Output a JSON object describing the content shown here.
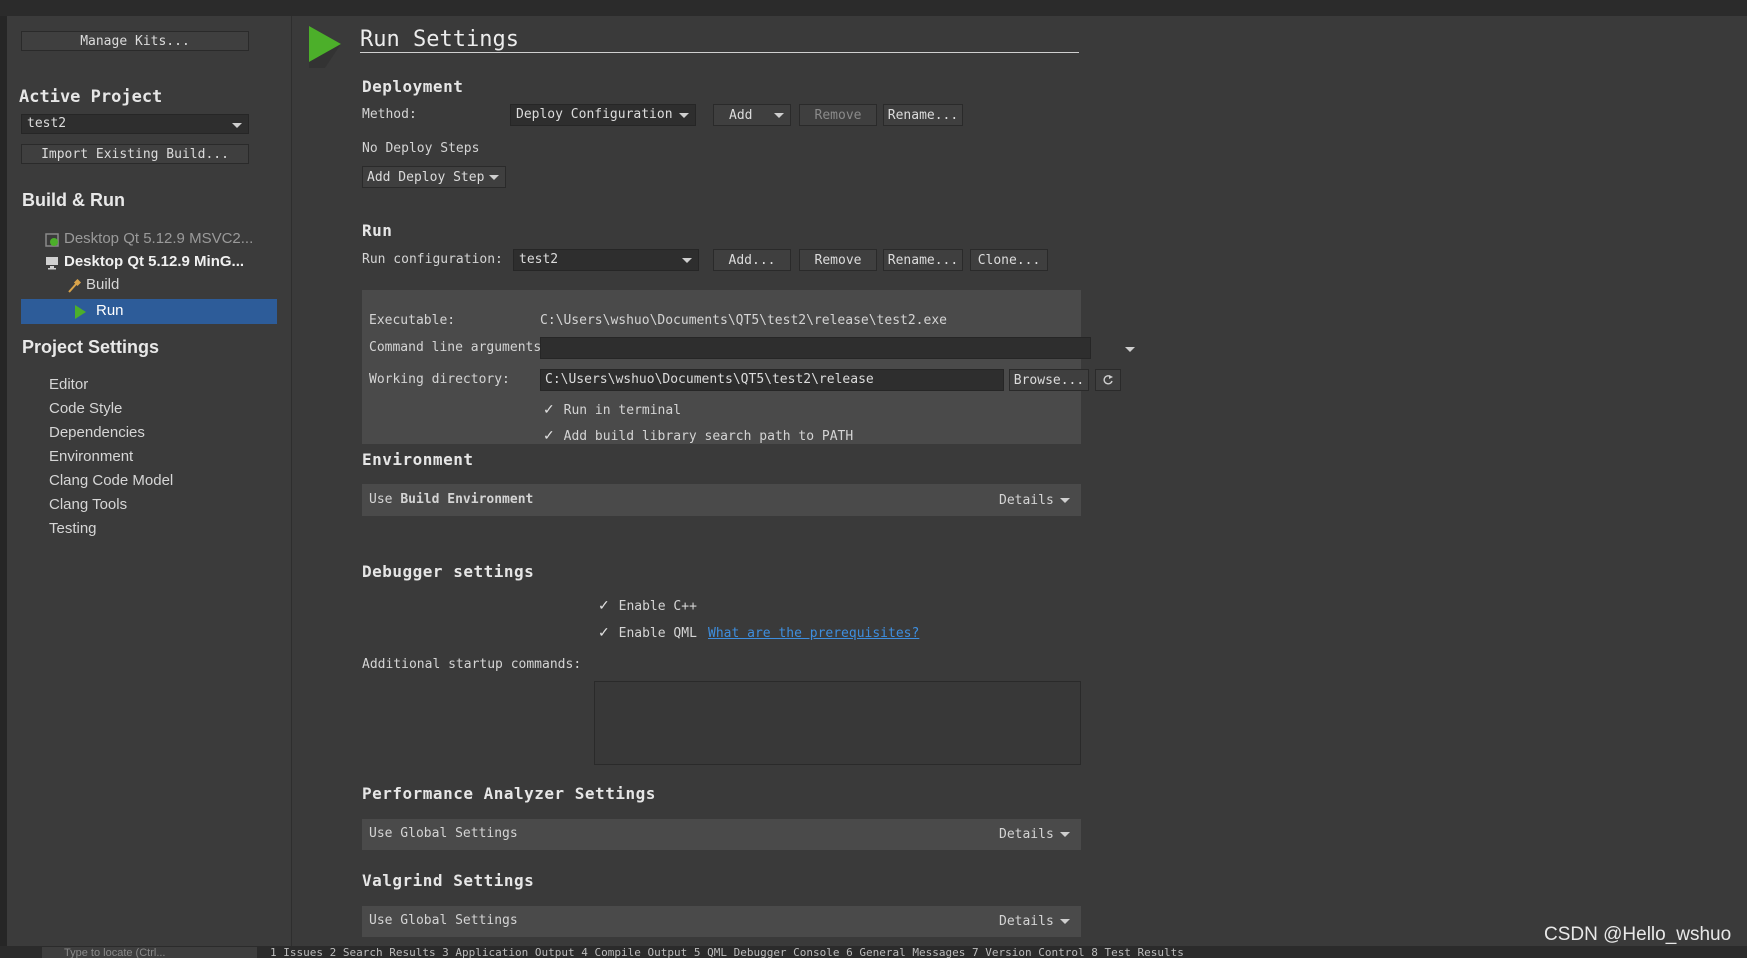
{
  "sidebar": {
    "manage_kits": "Manage Kits...",
    "active_project_heading": "Active Project",
    "project_select": "test2",
    "import_button": "Import Existing Build...",
    "build_run_heading": "Build & Run",
    "kits": [
      {
        "label": "Desktop Qt 5.12.9 MSVC2...",
        "icon": "kit-add-icon",
        "state": "disabled"
      },
      {
        "label": "Desktop Qt 5.12.9 MinG...",
        "icon": "monitor-icon",
        "state": "active"
      }
    ],
    "build_item": "Build",
    "run_item": "Run",
    "project_settings_heading": "Project Settings",
    "settings_items": [
      "Editor",
      "Code Style",
      "Dependencies",
      "Environment",
      "Clang Code Model",
      "Clang Tools",
      "Testing"
    ],
    "selected_color": "#2d5c99"
  },
  "main": {
    "title": "Run Settings",
    "deployment": {
      "heading": "Deployment",
      "method_label": "Method:",
      "method_value": "Deploy Configuration",
      "add": "Add",
      "remove": "Remove",
      "rename": "Rename...",
      "no_steps": "No Deploy Steps",
      "add_step": "Add Deploy Step"
    },
    "run": {
      "heading": "Run",
      "config_label": "Run configuration:",
      "config_value": "test2",
      "add": "Add...",
      "remove": "Remove",
      "rename": "Rename...",
      "clone": "Clone...",
      "executable_label": "Executable:",
      "executable_value": "C:\\Users\\wshuo\\Documents\\QT5\\test2\\release\\test2.exe",
      "args_label": "Command line arguments:",
      "args_value": "",
      "workdir_label": "Working directory:",
      "workdir_value": "C:\\Users\\wshuo\\Documents\\QT5\\test2\\release",
      "browse": "Browse...",
      "run_in_terminal": "Run in terminal",
      "add_lib_path": "Add build library search path to PATH"
    },
    "environment": {
      "heading": "Environment",
      "use_prefix": "Use",
      "use_value": "Build Environment",
      "details": "Details"
    },
    "debugger": {
      "heading": "Debugger settings",
      "enable_cpp": "Enable C++",
      "enable_qml": "Enable QML",
      "prereq_link": "What are the prerequisites?",
      "startup_label": "Additional startup commands:",
      "link_color": "#3e8ede"
    },
    "perf": {
      "heading": "Performance Analyzer Settings",
      "use_global": "Use Global Settings",
      "details": "Details"
    },
    "valgrind": {
      "heading": "Valgrind Settings",
      "use_global": "Use Global Settings",
      "details": "Details"
    }
  },
  "statusbar": {
    "search_placeholder": "Type to locate (Ctrl...",
    "tabs": "1 Issues  2 Search Results  3 Application Output  4 Compile Output  5 QML Debugger Console  6 General Messages  7 Version Control  8 Test Results"
  },
  "watermark": "CSDN @Hello_wshuo",
  "accent_green": "#4caf2a"
}
